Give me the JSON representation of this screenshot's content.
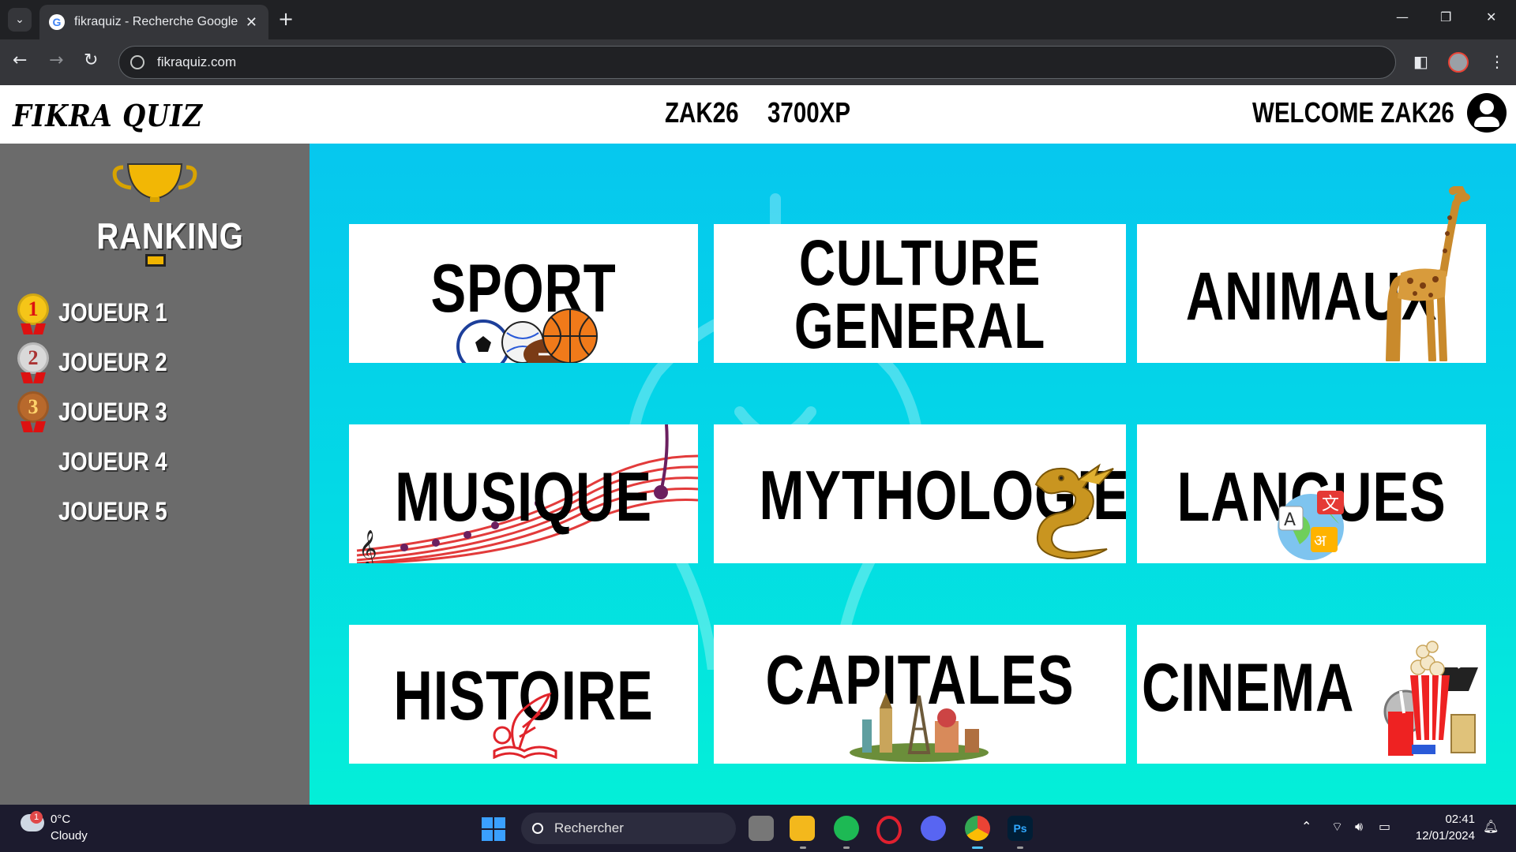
{
  "browser": {
    "tab_title": "fikraquiz - Recherche Google",
    "url": "fikraquiz.com"
  },
  "header": {
    "logo": "FIKRA QUIZ",
    "username": "ZAK26",
    "xp": "3700XP",
    "welcome": "WELCOME ZAK26"
  },
  "ranking": {
    "title": "RANKING",
    "players": [
      {
        "medal": "1",
        "name": "JOUEUR 1"
      },
      {
        "medal": "2",
        "name": "JOUEUR 2"
      },
      {
        "medal": "3",
        "name": "JOUEUR 3"
      },
      {
        "medal": "",
        "name": "JOUEUR 4"
      },
      {
        "medal": "",
        "name": "JOUEUR 5"
      }
    ],
    "colors": {
      "gold": "#f5c518",
      "silver": "#c9c9c9",
      "bronze": "#b8692c"
    }
  },
  "categories": [
    {
      "label": "SPORT",
      "icon": "sport-balls-icon"
    },
    {
      "label": "CULTURE GENERAL",
      "icon": ""
    },
    {
      "label": "ANIMAUX",
      "icon": "giraffe-icon"
    },
    {
      "label": "MUSIQUE",
      "icon": "music-notes-icon"
    },
    {
      "label": "MYTHOLOGIE",
      "icon": "dragon-icon"
    },
    {
      "label": "LANGUES",
      "icon": "translate-icon"
    },
    {
      "label": "HISTOIRE",
      "icon": "history-quill-book-icon"
    },
    {
      "label": "CAPITALES",
      "icon": "world-landmarks-icon"
    },
    {
      "label": "CINEMA",
      "icon": "popcorn-film-icon"
    }
  ],
  "taskbar": {
    "weather_temp": "0°C",
    "weather_condition": "Cloudy",
    "weather_badge": "1",
    "search_placeholder": "Rechercher",
    "clock_time": "02:41",
    "clock_date": "12/01/2024"
  },
  "theme": {
    "quiz_bg_top": "#06c7ee",
    "quiz_bg_bottom": "#04efd8",
    "sidebar_bg": "#6b6b6b",
    "browser_dark": "#202124"
  }
}
